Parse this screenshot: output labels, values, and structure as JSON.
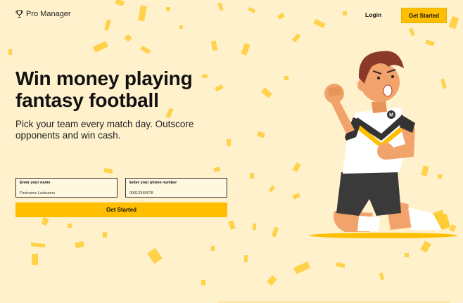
{
  "navbar": {
    "brand_name": "Pro Manager",
    "brand_icon": "trophy-icon",
    "login_label": "Login",
    "cta_label": "Get Started"
  },
  "hero": {
    "title": "Win money playing fantasy football",
    "subtitle": "Pick your team every match day. Outscore opponents and win cash."
  },
  "form": {
    "name_label": "Enter your name",
    "name_placeholder": "Firstname Lastname",
    "phone_label": "Enter your phone number",
    "phone_placeholder": "09012345678",
    "submit_label": "Get Started"
  },
  "illustration": {
    "jersey_badge": "M"
  },
  "colors": {
    "background": "#fff1cc",
    "accent": "#ffbf00",
    "confetti": "#ffcc33",
    "text": "#111111"
  }
}
